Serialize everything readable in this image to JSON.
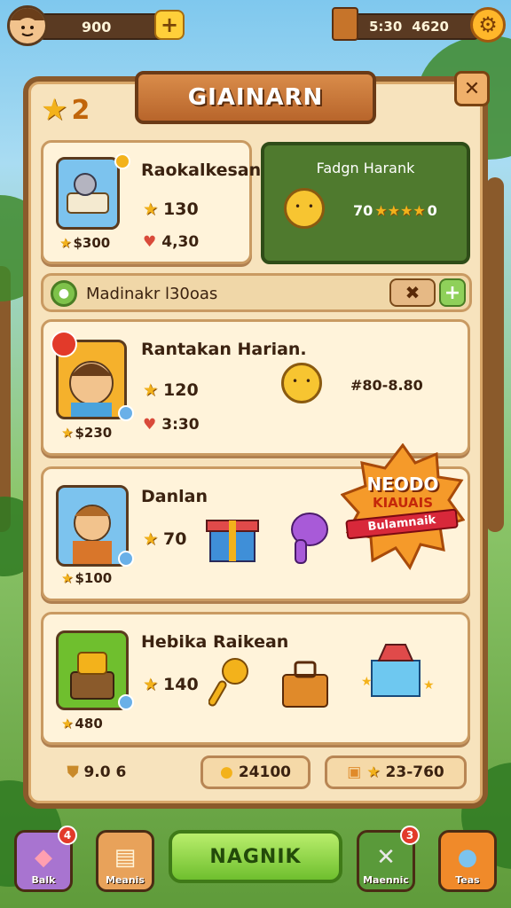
{
  "hud": {
    "coins": "900",
    "time": "5:30",
    "gems": "4620"
  },
  "panel": {
    "title": "GIAINARN",
    "level": "2"
  },
  "card1": {
    "title": "Raokalkesan",
    "stars": "130",
    "hearts": "4,30",
    "price": "$300"
  },
  "green_card": {
    "title": "Fadgn Harank",
    "value": "70",
    "value_end": "0"
  },
  "search": {
    "text": "Madinakr l30oas"
  },
  "card2": {
    "title": "Rantakan Harian.",
    "stars": "120",
    "hearts": "3:30",
    "price": "$230",
    "right_text": "#80-8.80"
  },
  "card3": {
    "title": "Danlan",
    "stars": "70",
    "price": "$100"
  },
  "promo": {
    "line1": "NEODO",
    "line2": "KIAUAIS",
    "line3": "Bulamnaik"
  },
  "card4": {
    "title": "Hebika Raikean",
    "stars": "140",
    "price": "480"
  },
  "footer": {
    "left": "9.0 6",
    "middle": "24100",
    "right": "23-760"
  },
  "nav": {
    "item1": "Balk",
    "item1_badge": "4",
    "item2": "Meanis",
    "main": "NAGNIK",
    "item4": "Maennic",
    "item4_badge": "3",
    "item5": "Teas"
  },
  "colors": {
    "panel_bg": "#f7e3bd",
    "wood": "#8b5a2b",
    "green_button": "#6fbf2e",
    "star": "#f3b21b"
  }
}
